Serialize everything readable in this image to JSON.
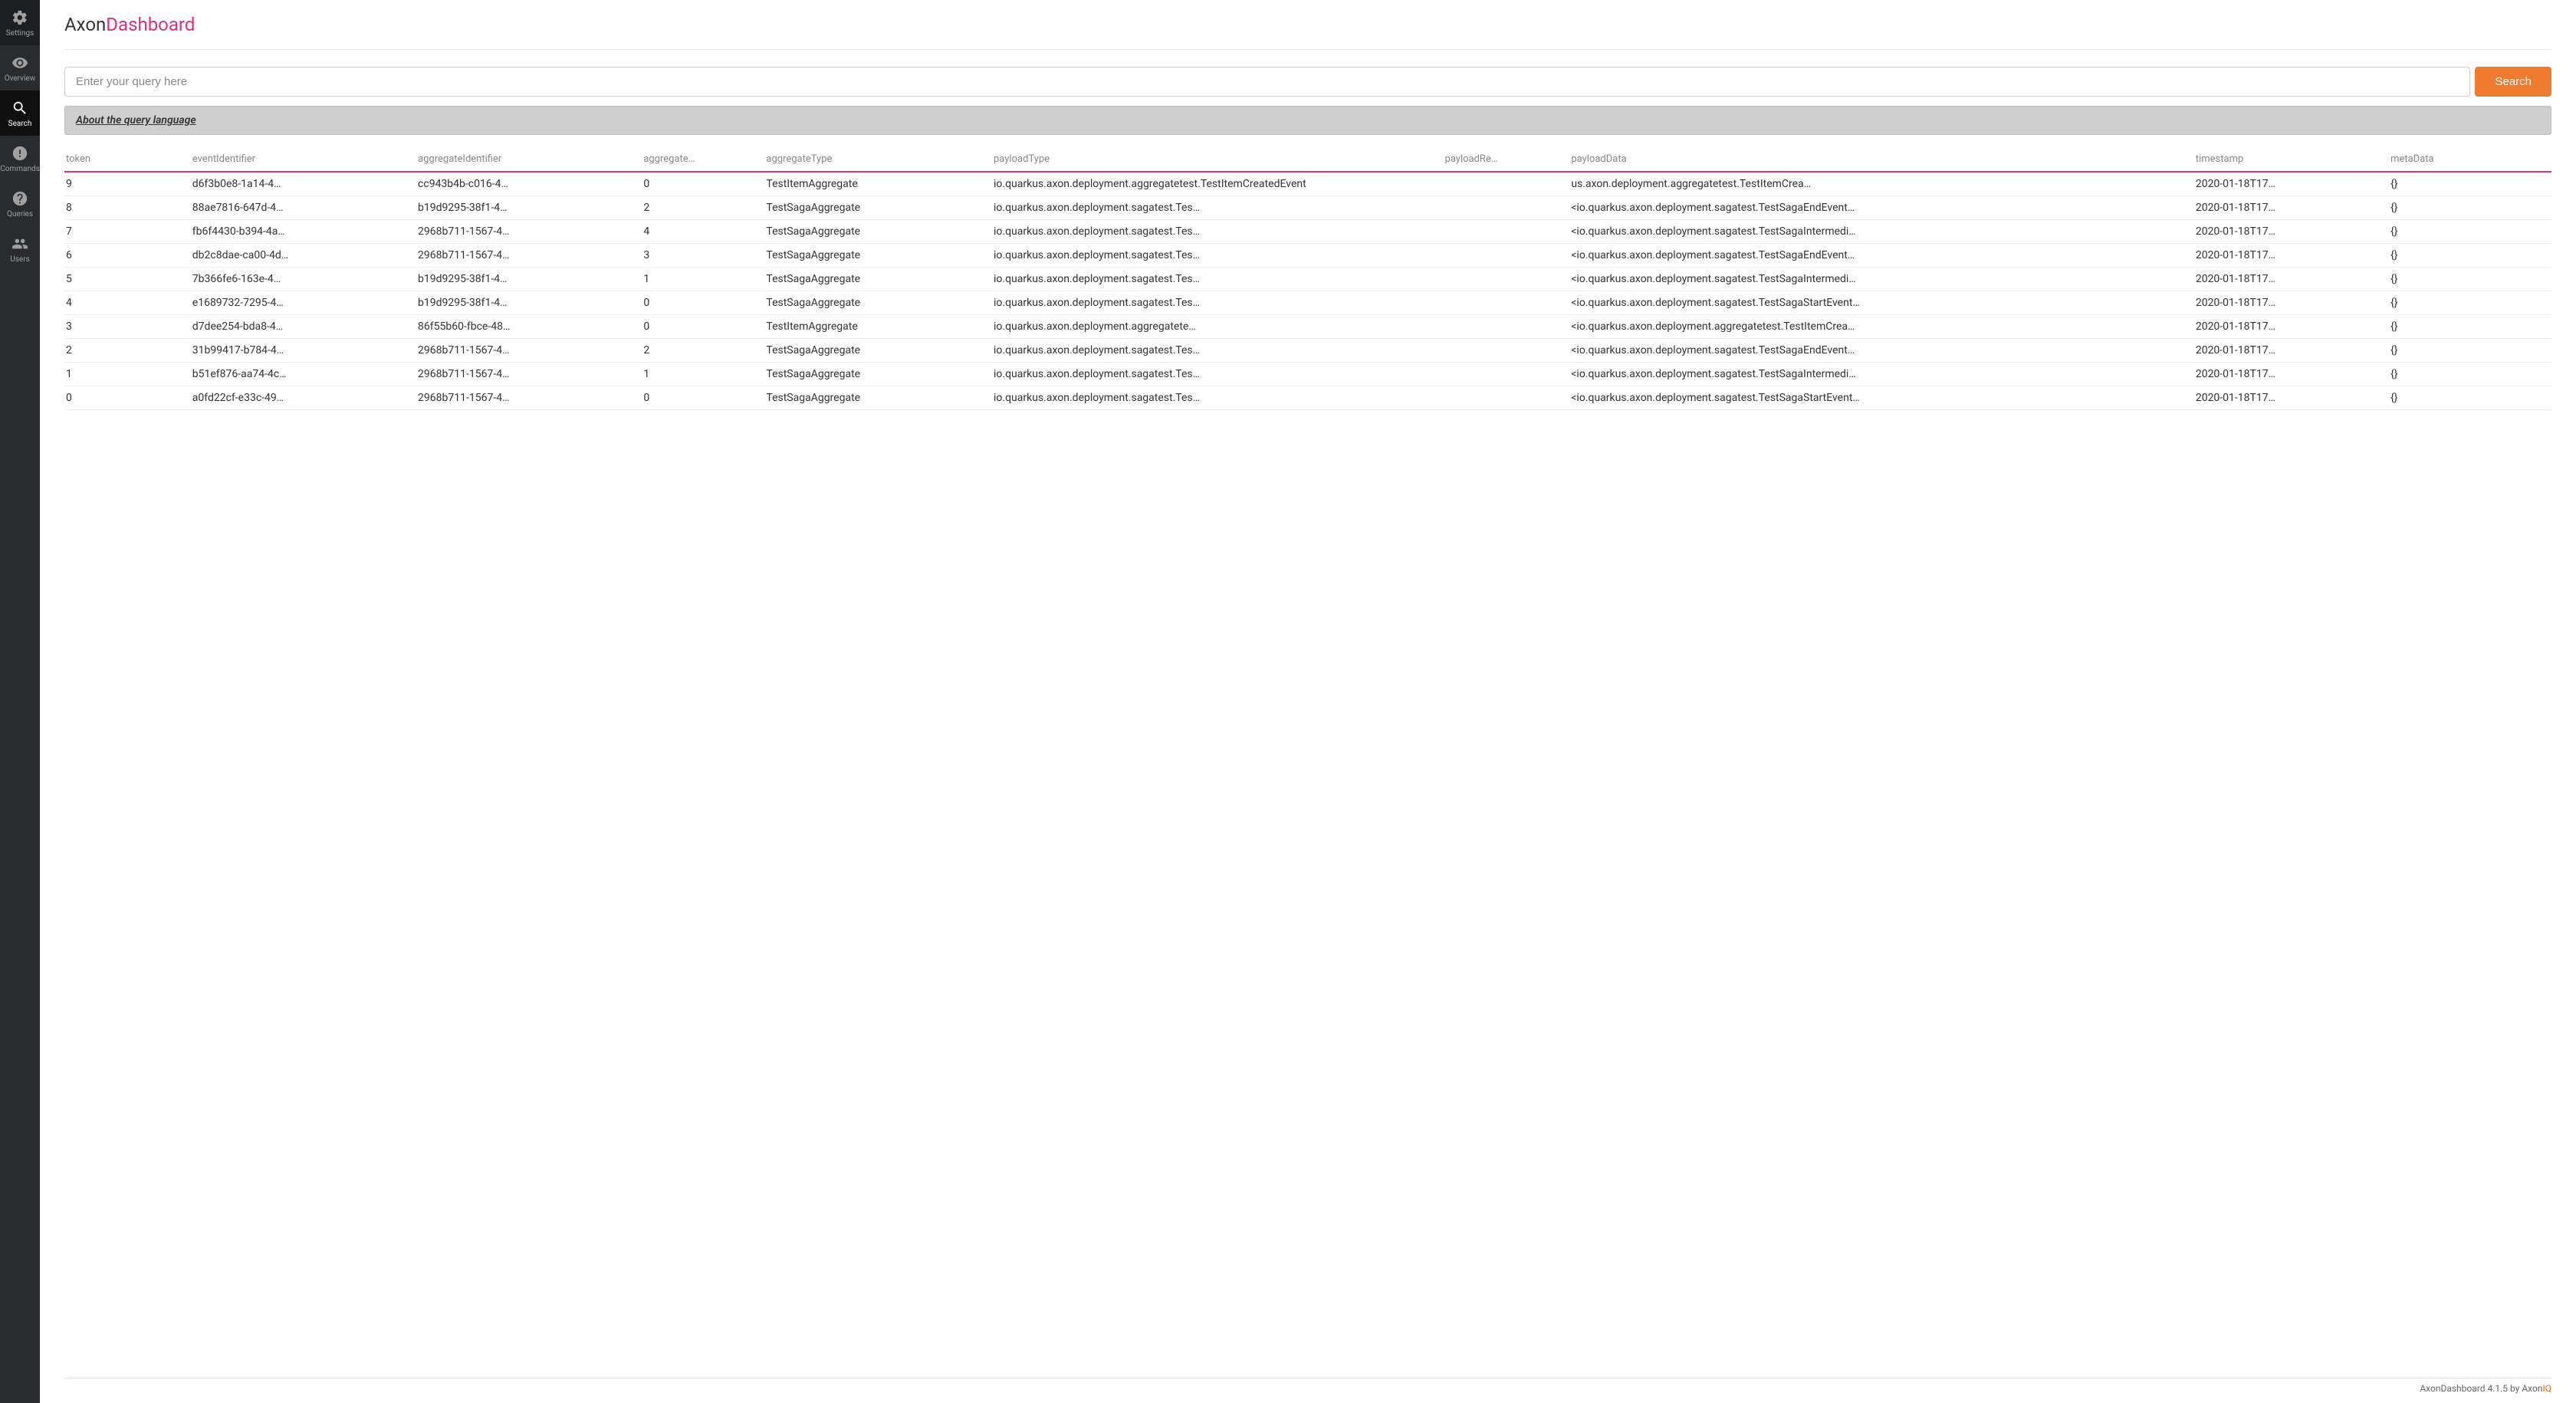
{
  "brand": {
    "prefix": "Axon",
    "suffix": "Dashboard"
  },
  "sidebar": {
    "items": [
      {
        "label": "Settings",
        "icon": "gear"
      },
      {
        "label": "Overview",
        "icon": "eye"
      },
      {
        "label": "Search",
        "icon": "search"
      },
      {
        "label": "Commands",
        "icon": "exclamation"
      },
      {
        "label": "Queries",
        "icon": "question"
      },
      {
        "label": "Users",
        "icon": "users"
      }
    ],
    "activeIndex": 2
  },
  "search": {
    "placeholder": "Enter your query here",
    "value": "",
    "buttonLabel": "Search",
    "aboutLabel": "About the query language"
  },
  "table": {
    "headers": [
      "token",
      "eventIdentifier",
      "aggregateIdentifier",
      "aggregate…",
      "aggregateType",
      "payloadType",
      "payloadRe…",
      "payloadData",
      "timestamp",
      "metaData"
    ],
    "rows": [
      {
        "token": "9",
        "eventIdentifier": "d6f3b0e8-1a14-4…",
        "aggregateIdentifier": "cc943b4b-c016-4…",
        "aggregateSeq": "0",
        "aggregateType": "TestItemAggregate",
        "payloadType": "io.quarkus.axon.deployment.aggregatetest.TestItemCreatedEvent",
        "payloadRev": "",
        "payloadData": "us.axon.deployment.aggregatetest.TestItemCrea…",
        "timestamp": "2020-01-18T17…",
        "metaData": "{}"
      },
      {
        "token": "8",
        "eventIdentifier": "88ae7816-647d-4…",
        "aggregateIdentifier": "b19d9295-38f1-4…",
        "aggregateSeq": "2",
        "aggregateType": "TestSagaAggregate",
        "payloadType": "io.quarkus.axon.deployment.sagatest.Tes…",
        "payloadRev": "",
        "payloadData": "<io.quarkus.axon.deployment.sagatest.TestSagaEndEvent…",
        "timestamp": "2020-01-18T17…",
        "metaData": "{}"
      },
      {
        "token": "7",
        "eventIdentifier": "fb6f4430-b394-4a…",
        "aggregateIdentifier": "2968b711-1567-4…",
        "aggregateSeq": "4",
        "aggregateType": "TestSagaAggregate",
        "payloadType": "io.quarkus.axon.deployment.sagatest.Tes…",
        "payloadRev": "",
        "payloadData": "<io.quarkus.axon.deployment.sagatest.TestSagaIntermedi…",
        "timestamp": "2020-01-18T17…",
        "metaData": "{}"
      },
      {
        "token": "6",
        "eventIdentifier": "db2c8dae-ca00-4d…",
        "aggregateIdentifier": "2968b711-1567-4…",
        "aggregateSeq": "3",
        "aggregateType": "TestSagaAggregate",
        "payloadType": "io.quarkus.axon.deployment.sagatest.Tes…",
        "payloadRev": "",
        "payloadData": "<io.quarkus.axon.deployment.sagatest.TestSagaEndEvent…",
        "timestamp": "2020-01-18T17…",
        "metaData": "{}"
      },
      {
        "token": "5",
        "eventIdentifier": "7b366fe6-163e-4…",
        "aggregateIdentifier": "b19d9295-38f1-4…",
        "aggregateSeq": "1",
        "aggregateType": "TestSagaAggregate",
        "payloadType": "io.quarkus.axon.deployment.sagatest.Tes…",
        "payloadRev": "",
        "payloadData": "<io.quarkus.axon.deployment.sagatest.TestSagaIntermedi…",
        "timestamp": "2020-01-18T17…",
        "metaData": "{}"
      },
      {
        "token": "4",
        "eventIdentifier": "e1689732-7295-4…",
        "aggregateIdentifier": "b19d9295-38f1-4…",
        "aggregateSeq": "0",
        "aggregateType": "TestSagaAggregate",
        "payloadType": "io.quarkus.axon.deployment.sagatest.Tes…",
        "payloadRev": "",
        "payloadData": "<io.quarkus.axon.deployment.sagatest.TestSagaStartEvent…",
        "timestamp": "2020-01-18T17…",
        "metaData": "{}"
      },
      {
        "token": "3",
        "eventIdentifier": "d7dee254-bda8-4…",
        "aggregateIdentifier": "86f55b60-fbce-48…",
        "aggregateSeq": "0",
        "aggregateType": "TestItemAggregate",
        "payloadType": "io.quarkus.axon.deployment.aggregatete…",
        "payloadRev": "",
        "payloadData": "<io.quarkus.axon.deployment.aggregatetest.TestItemCrea…",
        "timestamp": "2020-01-18T17…",
        "metaData": "{}"
      },
      {
        "token": "2",
        "eventIdentifier": "31b99417-b784-4…",
        "aggregateIdentifier": "2968b711-1567-4…",
        "aggregateSeq": "2",
        "aggregateType": "TestSagaAggregate",
        "payloadType": "io.quarkus.axon.deployment.sagatest.Tes…",
        "payloadRev": "",
        "payloadData": "<io.quarkus.axon.deployment.sagatest.TestSagaEndEvent…",
        "timestamp": "2020-01-18T17…",
        "metaData": "{}"
      },
      {
        "token": "1",
        "eventIdentifier": "b51ef876-aa74-4c…",
        "aggregateIdentifier": "2968b711-1567-4…",
        "aggregateSeq": "1",
        "aggregateType": "TestSagaAggregate",
        "payloadType": "io.quarkus.axon.deployment.sagatest.Tes…",
        "payloadRev": "",
        "payloadData": "<io.quarkus.axon.deployment.sagatest.TestSagaIntermedi…",
        "timestamp": "2020-01-18T17…",
        "metaData": "{}"
      },
      {
        "token": "0",
        "eventIdentifier": "a0fd22cf-e33c-49…",
        "aggregateIdentifier": "2968b711-1567-4…",
        "aggregateSeq": "0",
        "aggregateType": "TestSagaAggregate",
        "payloadType": "io.quarkus.axon.deployment.sagatest.Tes…",
        "payloadRev": "",
        "payloadData": "<io.quarkus.axon.deployment.sagatest.TestSagaStartEvent…",
        "timestamp": "2020-01-18T17…",
        "metaData": "{}"
      }
    ]
  },
  "footer": {
    "prefix": "AxonDashboard 4.1.5 by ",
    "brand": "Axon",
    "brandSuffix": "IQ"
  }
}
